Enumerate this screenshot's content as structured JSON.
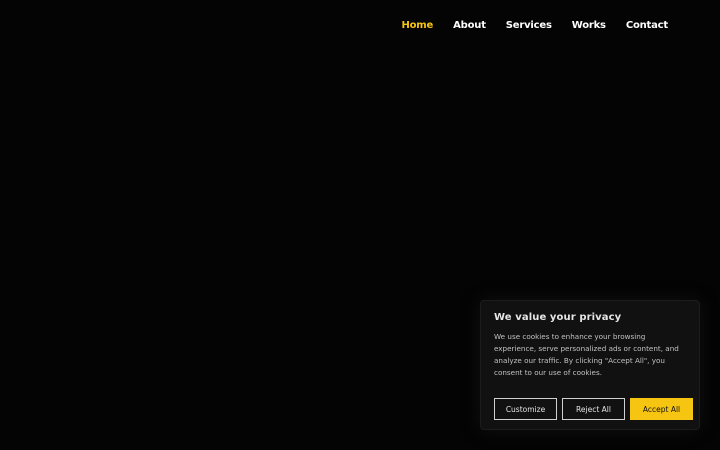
{
  "nav": {
    "items": [
      {
        "label": "Home",
        "active": true
      },
      {
        "label": "About",
        "active": false
      },
      {
        "label": "Services",
        "active": false
      },
      {
        "label": "Works",
        "active": false
      },
      {
        "label": "Contact",
        "active": false
      }
    ]
  },
  "cookie_banner": {
    "title": "We value your privacy",
    "text": "We use cookies to enhance your browsing experience, serve personalized ads or content, and analyze our traffic. By clicking \"Accept All\", you consent to our use of cookies.",
    "buttons": {
      "customize": "Customize",
      "reject": "Reject All",
      "accept": "Accept All"
    }
  },
  "colors": {
    "background": "#040404",
    "accent": "#f6c512",
    "nav_text": "#ffffff",
    "banner_bg": "#111111"
  }
}
